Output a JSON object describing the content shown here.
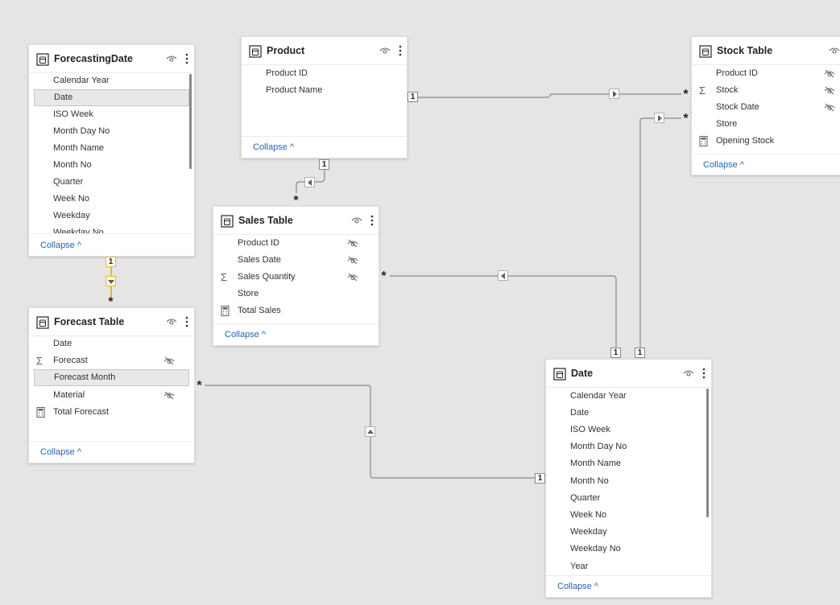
{
  "tables": {
    "forecasting_date": {
      "title": "ForecastingDate",
      "fields": [
        "Calendar Year",
        "Date",
        "ISO Week",
        "Month Day No",
        "Month Name",
        "Month No",
        "Quarter",
        "Week No",
        "Weekday",
        "Weekday No"
      ],
      "selected_index": 1,
      "collapse_label": "Collapse"
    },
    "product": {
      "title": "Product",
      "fields": [
        "Product ID",
        "Product Name"
      ],
      "collapse_label": "Collapse"
    },
    "stock_table": {
      "title": "Stock Table",
      "fields": [
        {
          "name": "Product ID",
          "icon": "none",
          "hidden": true
        },
        {
          "name": "Stock",
          "icon": "sigma",
          "hidden": true
        },
        {
          "name": "Stock Date",
          "icon": "none",
          "hidden": true
        },
        {
          "name": "Store",
          "icon": "none",
          "hidden": false
        },
        {
          "name": "Opening Stock",
          "icon": "calculator",
          "hidden": false
        }
      ],
      "collapse_label": "Collapse"
    },
    "sales_table": {
      "title": "Sales Table",
      "fields": [
        {
          "name": "Product ID",
          "icon": "none",
          "hidden": true
        },
        {
          "name": "Sales Date",
          "icon": "none",
          "hidden": true
        },
        {
          "name": "Sales Quantity",
          "icon": "sigma",
          "hidden": true
        },
        {
          "name": "Store",
          "icon": "none",
          "hidden": false
        },
        {
          "name": "Total Sales",
          "icon": "calculator",
          "hidden": false
        }
      ],
      "collapse_label": "Collapse"
    },
    "forecast_table": {
      "title": "Forecast Table",
      "fields": [
        {
          "name": "Date",
          "icon": "none",
          "hidden": false
        },
        {
          "name": "Forecast",
          "icon": "sigma",
          "hidden": true
        },
        {
          "name": "Forecast Month",
          "icon": "none",
          "hidden": false
        },
        {
          "name": "Material",
          "icon": "none",
          "hidden": true
        },
        {
          "name": "Total Forecast",
          "icon": "calculator",
          "hidden": false
        }
      ],
      "selected_index": 2,
      "collapse_label": "Collapse"
    },
    "date": {
      "title": "Date",
      "fields": [
        "Calendar Year",
        "Date",
        "ISO Week",
        "Month Day No",
        "Month Name",
        "Month No",
        "Quarter",
        "Week No",
        "Weekday",
        "Weekday No",
        "Year"
      ],
      "collapse_label": "Collapse"
    }
  },
  "relationships": {
    "one_label": "1",
    "many_label": "*"
  },
  "colors": {
    "canvas": "#e7e5e4",
    "line": "#8a8886",
    "link": "#2564b0",
    "highlight": "#e0b93b"
  }
}
